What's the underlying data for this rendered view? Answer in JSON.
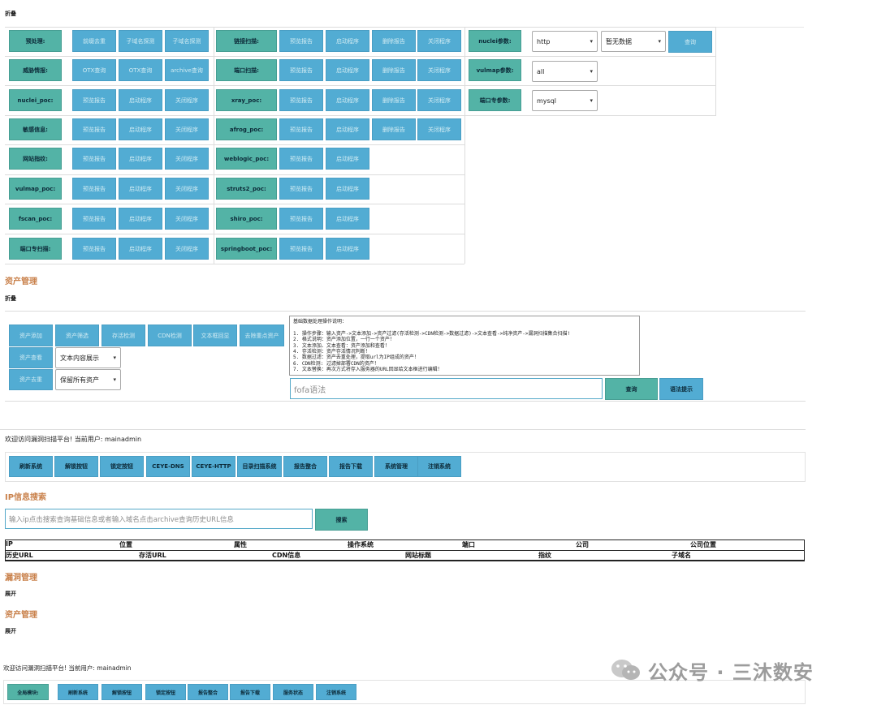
{
  "top": {
    "collapse_label": "折叠",
    "grid": {
      "col1": [
        {
          "label": "预处理:",
          "buttons": [
            "前缀去重",
            "子域名探测",
            "子域名探测"
          ]
        },
        {
          "label": "威胁情报:",
          "buttons": [
            "OTX查询",
            "OTX查询",
            "archive查询"
          ]
        },
        {
          "label": "nuclei_poc:",
          "buttons": [
            "预览报告",
            "启动程序",
            "关闭程序"
          ]
        },
        {
          "label": "敏感信息:",
          "buttons": [
            "预览报告",
            "启动程序",
            "关闭程序"
          ]
        },
        {
          "label": "网站指纹:",
          "buttons": [
            "预览报告",
            "启动程序",
            "关闭程序"
          ]
        },
        {
          "label": "vulmap_poc:",
          "buttons": [
            "预览报告",
            "启动程序",
            "关闭程序"
          ]
        },
        {
          "label": "fscan_poc:",
          "buttons": [
            "预览报告",
            "启动程序",
            "关闭程序"
          ]
        },
        {
          "label": "端口专扫描:",
          "buttons": [
            "预览报告",
            "启动程序",
            "关闭程序"
          ]
        }
      ],
      "col2": [
        {
          "label": "链接扫描:",
          "buttons": [
            "预览报告",
            "启动程序",
            "删除报告",
            "关闭程序"
          ]
        },
        {
          "label": "端口扫描:",
          "buttons": [
            "预览报告",
            "启动程序",
            "删除报告",
            "关闭程序"
          ]
        },
        {
          "label": "xray_poc:",
          "buttons": [
            "预览报告",
            "启动程序",
            "删除报告",
            "关闭程序"
          ]
        },
        {
          "label": "afrog_poc:",
          "buttons": [
            "预览报告",
            "启动程序",
            "删除报告",
            "关闭程序"
          ]
        },
        {
          "label": "weblogic_poc:",
          "buttons": [
            "预览报告",
            "启动程序"
          ]
        },
        {
          "label": "struts2_poc:",
          "buttons": [
            "预览报告",
            "启动程序"
          ]
        },
        {
          "label": "shiro_poc:",
          "buttons": [
            "预览报告",
            "启动程序"
          ]
        },
        {
          "label": "springboot_poc:",
          "buttons": [
            "预览报告",
            "启动程序"
          ]
        }
      ],
      "col3": [
        {
          "label": "nuclei参数:",
          "select1": "http",
          "select2": "暂无数据",
          "button": "查询"
        },
        {
          "label": "vulmap参数:",
          "select1": "all"
        },
        {
          "label": "端口专参数:",
          "select1": "mysql"
        }
      ]
    }
  },
  "asset": {
    "title": "资产管理",
    "collapse_label": "折叠",
    "row1": [
      "资产添加",
      "资产筛选",
      "存活检测",
      "CDN检测",
      "文本框回显",
      "去除重点资产"
    ],
    "row2_button": "资产查看",
    "row2_select": "文本内容展示",
    "row3_button": "资产去重",
    "row3_select": "保留所有资产",
    "textarea_lines": [
      "基础数据处理操作说明：",
      "",
      "1. 操作步骤：输入资产->文本添加->资产过滤(存活检测->CDN检测->数据过滤)->文本查看->纯净资产->漏洞扫描集合扫描!",
      "2. 格式说明：资产添加位置，一行一个资产！",
      "3. 文本添加、文本查看：资产添加和查看！",
      "4. 存活检测：资产存活情况判断！",
      "5. 数据过滤：资产去重处理，提取url为IP组成的资产！",
      "6. CDN检测: 过滤掉部署CDN的资产！",
      "7. 文本替换：再次方式将存入服务器的URL回显给文本框进行编辑！"
    ],
    "fofa_placeholder": "fofa语法",
    "query_button": "查询",
    "hint_button": "语法提示"
  },
  "welcome1": {
    "text": "欢迎访问漏洞扫描平台!  当前用户: mainadmin",
    "buttons": [
      "刷新系统",
      "解锁按钮",
      "锁定按钮",
      "CEYE-DNS",
      "CEYE-HTTP",
      "目录扫描系统",
      "报告整合",
      "报告下载",
      "系统管理",
      "注销系统"
    ]
  },
  "ip_search": {
    "title": "IP信息搜索",
    "placeholder": "输入ip点击搜索查询基础信息或者输入域名点击archive查询历史URL信息",
    "button": "搜索",
    "header1": [
      "IP",
      "位置",
      "属性",
      "操作系统",
      "端口",
      "公司",
      "公司位置"
    ],
    "header2": [
      "历史URL",
      "存活URL",
      "CDN信息",
      "网站标题",
      "指纹",
      "子域名"
    ]
  },
  "vuln": {
    "title": "漏洞管理",
    "expand": "展开"
  },
  "asset2": {
    "title": "资产管理",
    "expand": "展开"
  },
  "welcome2": {
    "text": "欢迎访问漏洞扫描平台!  当前用户: mainadmin",
    "label": "全局模块:",
    "buttons": [
      "刷新系统",
      "解锁按钮",
      "锁定按钮",
      "报告整合",
      "报告下载",
      "服务状态",
      "注销系统"
    ]
  },
  "watermark": "公众号 · 三沐数安",
  "colors": {
    "button": "#52acd3",
    "label": "#53b3a6",
    "section": "#c9814b"
  }
}
